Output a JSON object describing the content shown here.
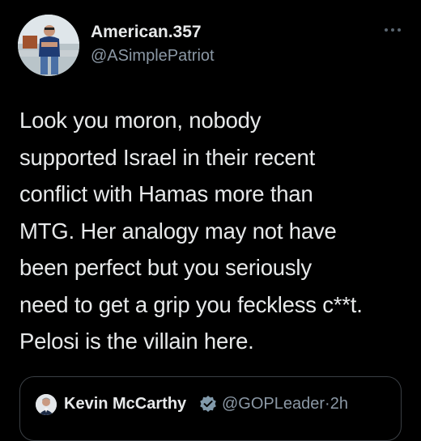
{
  "author": {
    "display_name": "American.357",
    "handle": "@ASimplePatriot"
  },
  "tweet": {
    "lines": [
      "Look you moron, nobody",
      "supported Israel in their recent",
      "conflict with Hamas more than",
      "MTG. Her analogy may not have",
      "been perfect but you seriously",
      "need to get a grip you feckless c**t.",
      "Pelosi is the villain here."
    ]
  },
  "quoted": {
    "display_name": "Kevin McCarthy",
    "handle": "@GOPLeader",
    "separator": "·",
    "time": "2h",
    "verified_icon": "verified-badge-icon"
  },
  "icons": {
    "more": "more-options-icon"
  },
  "colors": {
    "background": "#000000",
    "primary_text": "#e7e9ea",
    "secondary_text": "#8b98a5",
    "border": "#3a3f44",
    "verified_badge": "#829aab"
  }
}
